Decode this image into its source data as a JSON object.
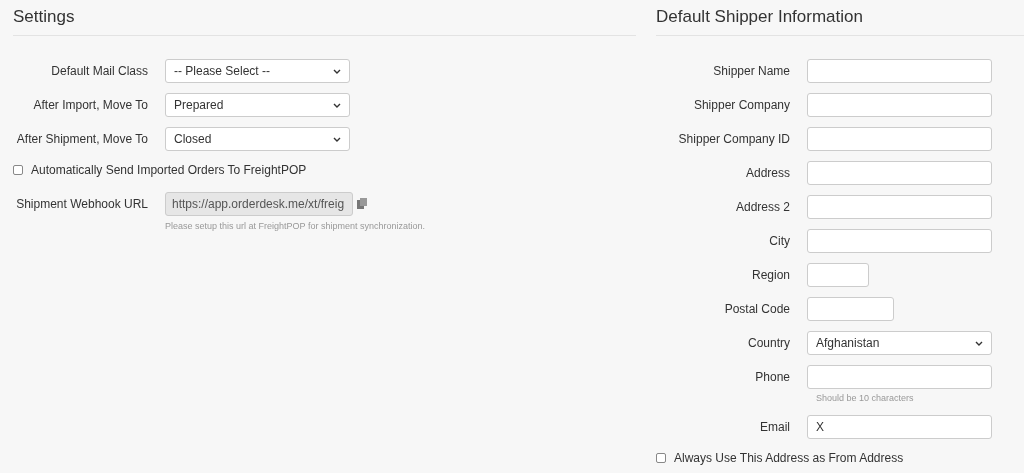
{
  "settings": {
    "title": "Settings",
    "fields": [
      {
        "label": "Default Mail Class",
        "kind": "select",
        "value": "-- Please Select --"
      },
      {
        "label": "After Import, Move To",
        "kind": "select",
        "value": "Prepared"
      },
      {
        "label": "After Shipment, Move To",
        "kind": "select",
        "value": "Closed"
      }
    ],
    "auto_send": {
      "label": "Automatically Send Imported Orders To FreightPOP",
      "checked": false
    },
    "webhook": {
      "label": "Shipment Webhook URL",
      "value": "https://app.orderdesk.me/xt/freig",
      "hint": "Please setup this url at FreightPOP for shipment synchronization."
    }
  },
  "shipper": {
    "title": "Default Shipper Information",
    "fields": [
      {
        "label": "Shipper Name",
        "kind": "text"
      },
      {
        "label": "Shipper Company",
        "kind": "text"
      },
      {
        "label": "Shipper Company ID",
        "kind": "text"
      },
      {
        "label": "Address",
        "kind": "text"
      },
      {
        "label": "Address 2",
        "kind": "text"
      },
      {
        "label": "City",
        "kind": "text"
      },
      {
        "label": "Region",
        "kind": "short"
      },
      {
        "label": "Postal Code",
        "kind": "medium"
      },
      {
        "label": "Country",
        "kind": "select",
        "value": "Afghanistan"
      },
      {
        "label": "Phone",
        "kind": "text",
        "hint": "Should be 10 characters"
      },
      {
        "label": "Email",
        "kind": "text",
        "value": "X"
      }
    ],
    "always_use": {
      "label": "Always Use This Address as From Address",
      "checked": false
    }
  }
}
